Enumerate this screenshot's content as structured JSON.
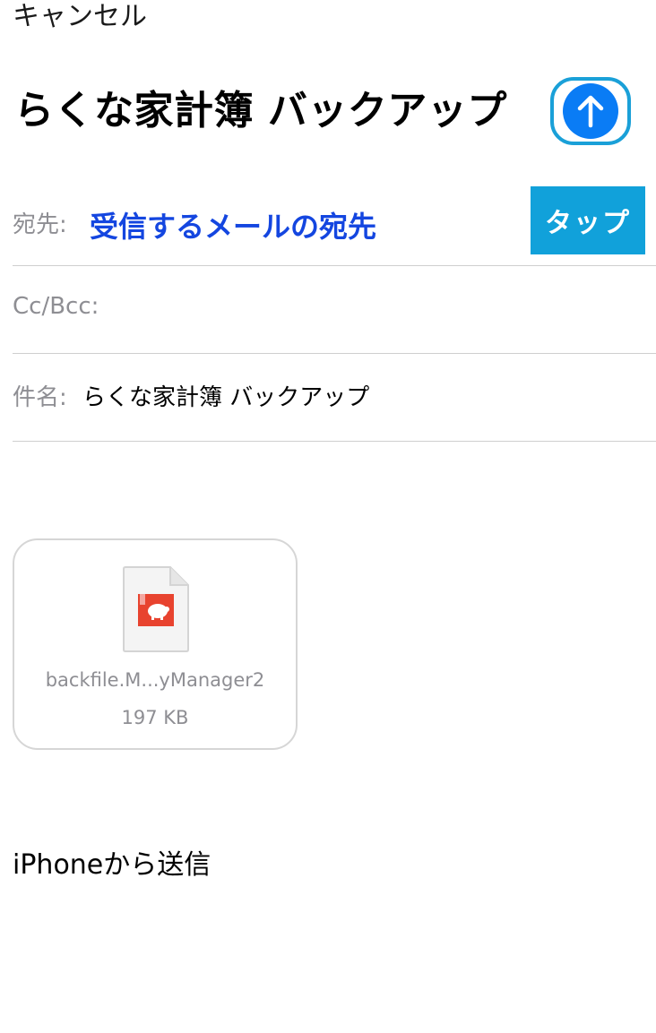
{
  "header": {
    "cancel_label": "キャンセル",
    "title": "らくな家計簿 バックアップ"
  },
  "send_button": {
    "icon": "arrow-up-icon",
    "color": "#0a7cf5"
  },
  "callout": {
    "label": "タップ",
    "color": "#11a1da"
  },
  "fields": {
    "to_label": "宛先:",
    "to_value": "受信するメールの宛先",
    "cc_label": "Cc/Bcc:",
    "subject_label": "件名:",
    "subject_value": "らくな家計簿 バックアップ"
  },
  "attachment": {
    "icon": "document-icon",
    "file_name": "backfile.M...yManager2",
    "file_size": "197 KB"
  },
  "body": {
    "signature": "iPhoneから送信"
  }
}
